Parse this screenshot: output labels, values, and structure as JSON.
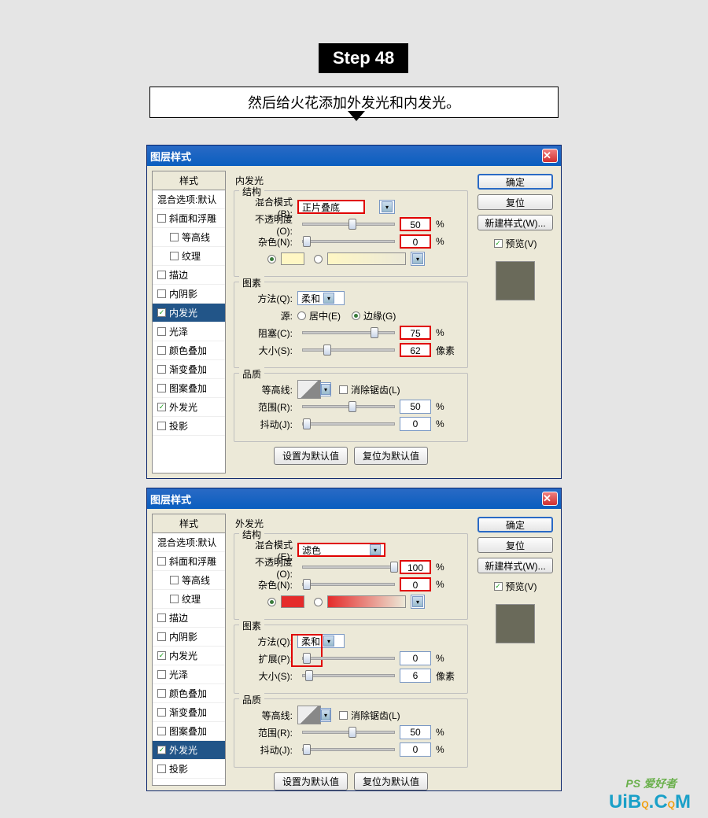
{
  "step": {
    "badge": "Step 48",
    "caption": "然后给火花添加外发光和内发光。"
  },
  "dialog_title": "图层样式",
  "left": {
    "header": "样式",
    "blend": "混合选项:默认",
    "bevel": "斜面和浮雕",
    "contour_sub": "等高线",
    "texture_sub": "纹理",
    "stroke": "描边",
    "inner_shadow": "内阴影",
    "inner_glow": "内发光",
    "satin": "光泽",
    "color_overlay": "颜色叠加",
    "grad_overlay": "渐变叠加",
    "pattern_overlay": "图案叠加",
    "outer_glow": "外发光",
    "drop_shadow": "投影"
  },
  "inner": {
    "title": "内发光",
    "g_struct": "结构",
    "blend_mode_l": "混合模式(B):",
    "blend_mode_v": "正片叠底",
    "opacity_l": "不透明度(O):",
    "opacity_v": "50",
    "noise_l": "杂色(N):",
    "noise_v": "0",
    "g_elem": "图素",
    "tech_l": "方法(Q):",
    "tech_v": "柔和",
    "source_l": "源:",
    "center": "居中(E)",
    "edge": "边缘(G)",
    "choke_l": "阻塞(C):",
    "choke_v": "75",
    "size_l": "大小(S):",
    "size_v": "62",
    "size_u": "像素",
    "g_qual": "品质",
    "contour_l": "等高线:",
    "anti_l": "消除锯齿(L)",
    "range_l": "范围(R):",
    "range_v": "50",
    "jitter_l": "抖动(J):",
    "jitter_v": "0"
  },
  "outer": {
    "title": "外发光",
    "g_struct": "结构",
    "blend_mode_l": "混合模式(E):",
    "blend_mode_v": "滤色",
    "opacity_l": "不透明度(O):",
    "opacity_v": "100",
    "noise_l": "杂色(N):",
    "noise_v": "0",
    "g_elem": "图素",
    "tech_l": "方法(Q):",
    "tech_v": "柔和",
    "spread_l": "扩展(P):",
    "spread_v": "0",
    "size_l": "大小(S):",
    "size_v": "6",
    "size_u": "像素",
    "g_qual": "品质",
    "contour_l": "等高线:",
    "anti_l": "消除锯齿(L)",
    "range_l": "范围(R):",
    "range_v": "50",
    "jitter_l": "抖动(J):",
    "jitter_v": "0"
  },
  "buttons": {
    "ok": "确定",
    "cancel": "复位",
    "new_style": "新建样式(W)...",
    "preview": "预览(V)",
    "set_default": "设置为默认值",
    "reset_default": "复位为默认值"
  },
  "pct": "%",
  "watermark": {
    "brand": "UiBQ.CQM",
    "sub": "PS 爱好者"
  }
}
